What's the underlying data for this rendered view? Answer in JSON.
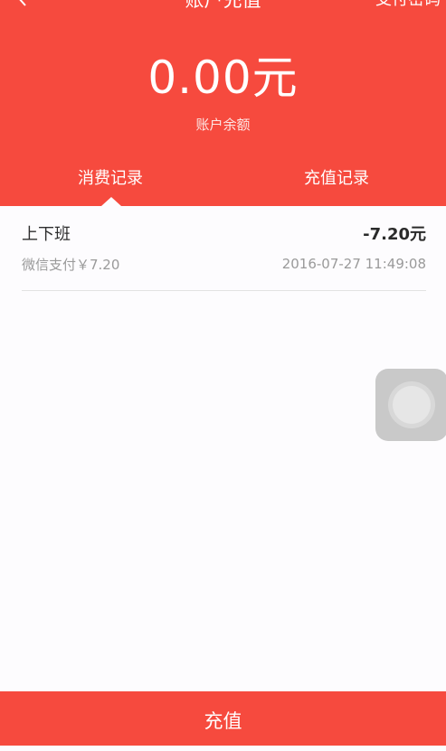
{
  "nav": {
    "title": "账户充值",
    "right_label": "支付密码"
  },
  "balance": {
    "amount": "0.00元",
    "label": "账户余额"
  },
  "tabs": [
    {
      "label": "消费记录",
      "active": true
    },
    {
      "label": "充值记录",
      "active": false
    }
  ],
  "records": [
    {
      "title": "上下班",
      "amount": "-7.20元",
      "payment": "微信支付￥7.20",
      "time": "2016-07-27 11:49:08"
    }
  ],
  "bottom": {
    "button_label": "充值"
  },
  "colors": {
    "brand": "#f64a3e",
    "background": "#fdfcfe"
  },
  "icons": {
    "back": "back-arrow-icon",
    "float": "assistive-touch-icon"
  }
}
